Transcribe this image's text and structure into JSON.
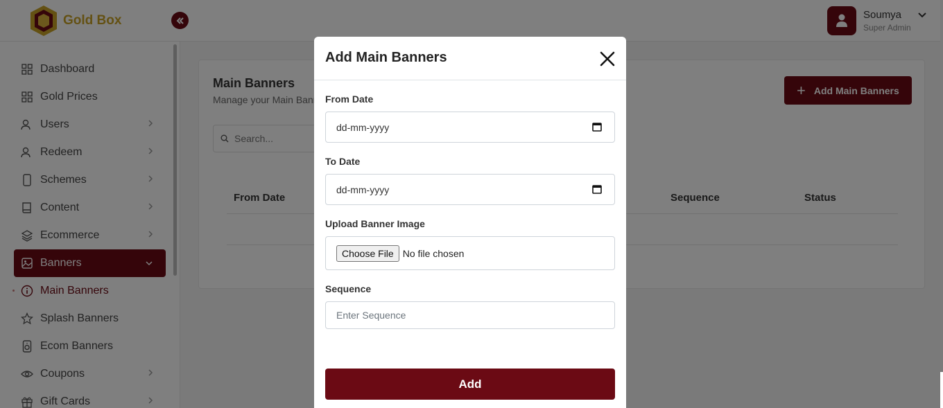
{
  "brand": {
    "name": "Gold Box"
  },
  "user": {
    "name": "Soumya",
    "role": "Super Admin"
  },
  "sidebar": {
    "items": [
      {
        "label": "Dashboard"
      },
      {
        "label": "Gold Prices"
      },
      {
        "label": "Users"
      },
      {
        "label": "Redeem"
      },
      {
        "label": "Schemes"
      },
      {
        "label": "Content"
      },
      {
        "label": "Ecommerce"
      },
      {
        "label": "Banners"
      },
      {
        "label": "Main Banners"
      },
      {
        "label": "Splash Banners"
      },
      {
        "label": "Ecom Banners"
      },
      {
        "label": "Coupons"
      },
      {
        "label": "Gift Cards"
      }
    ]
  },
  "page": {
    "title": "Main Banners",
    "subtitle": "Manage your Main Banners",
    "add_button": "Add Main Banners",
    "search_placeholder": "Search...",
    "columns": [
      "From Date",
      "Sequence",
      "Status"
    ]
  },
  "modal": {
    "title": "Add Main Banners",
    "from_date_label": "From Date",
    "from_date_value": "dd-mm-yyyy",
    "to_date_label": "To Date",
    "to_date_value": "dd-mm-yyyy",
    "upload_label": "Upload Banner Image",
    "choose_file": "Choose File",
    "no_file": "No file chosen",
    "sequence_label": "Sequence",
    "sequence_placeholder": "Enter Sequence",
    "submit": "Add"
  },
  "colors": {
    "primary": "#6b0a14",
    "gold": "#c9a227"
  }
}
